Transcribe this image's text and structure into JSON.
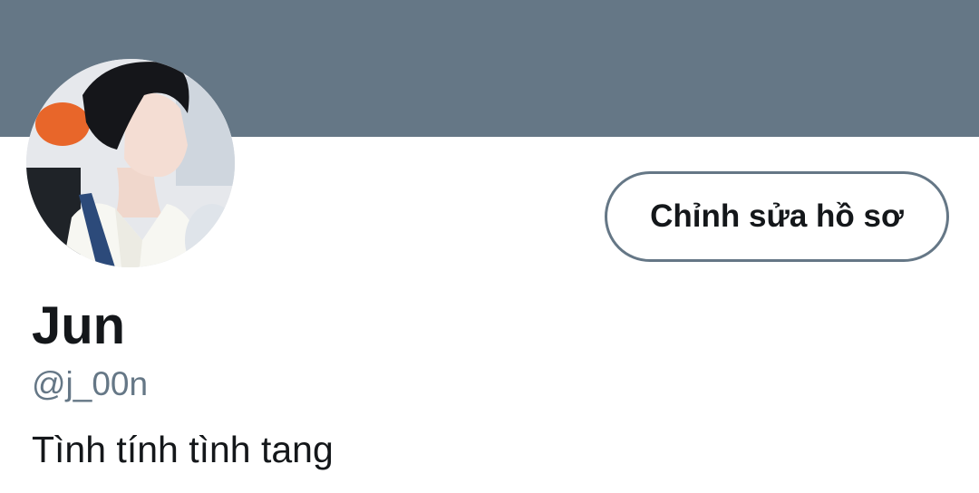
{
  "profile": {
    "display_name": "Jun",
    "handle": "@j_00n",
    "bio": "Tình tính tình tang",
    "edit_button_label": "Chỉnh sửa hồ sơ"
  },
  "colors": {
    "cover": "#657786",
    "text_primary": "#14171a",
    "text_secondary": "#657786",
    "button_border": "#657786"
  }
}
